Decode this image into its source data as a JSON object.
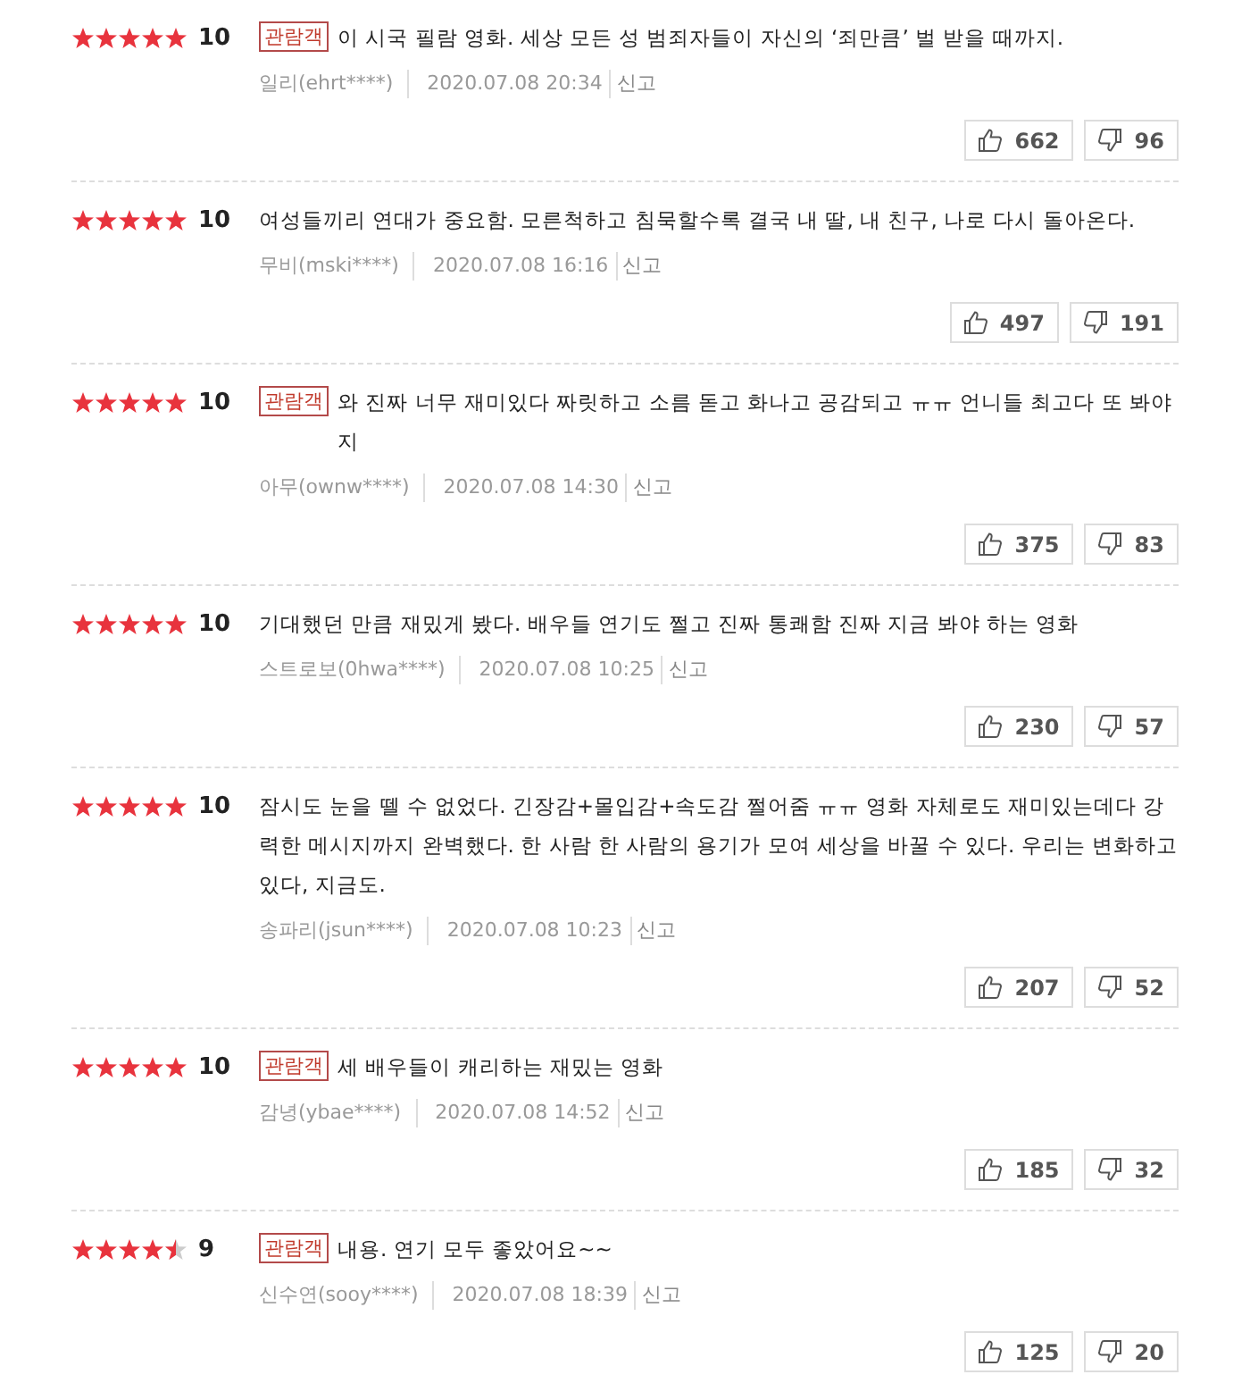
{
  "reviews": [
    {
      "stars": 5,
      "score": "10",
      "viewer_badge": "관람객",
      "text": "이 시국 필람 영화. 세상 모든 성 범죄자들이 자신의 ‘죄만큼’ 벌 받을 때까지.",
      "author": "일리(ehrt****)",
      "date": "2020.07.08 20:34",
      "report": "신고",
      "likes": "662",
      "dislikes": "96"
    },
    {
      "stars": 5,
      "score": "10",
      "text": "여성들끼리 연대가 중요함. 모른척하고 침묵할수록 결국 내 딸, 내 친구, 나로 다시 돌아온다.",
      "author": "무비(mski****)",
      "date": "2020.07.08 16:16",
      "report": "신고",
      "likes": "497",
      "dislikes": "191"
    },
    {
      "stars": 5,
      "score": "10",
      "viewer_badge": "관람객",
      "text": "와 진짜 너무 재미있다 짜릿하고 소름 돋고 화나고 공감되고 ㅠㅠ 언니들 최고다 또 봐야지",
      "author": "아무(ownw****)",
      "date": "2020.07.08 14:30",
      "report": "신고",
      "likes": "375",
      "dislikes": "83"
    },
    {
      "stars": 5,
      "score": "10",
      "text": "기대했던 만큼 재밌게 봤다. 배우들 연기도 쩔고 진짜 통쾌함 진짜 지금 봐야 하는 영화",
      "author": "스트로보(0hwa****)",
      "date": "2020.07.08 10:25",
      "report": "신고",
      "likes": "230",
      "dislikes": "57"
    },
    {
      "stars": 5,
      "score": "10",
      "text": "잠시도 눈을 뗄 수 없었다. 긴장감+몰입감+속도감 쩔어줌 ㅠㅠ 영화 자체로도 재미있는데다 강력한 메시지까지 완벽했다. 한 사람 한 사람의 용기가 모여 세상을 바꿀 수 있다. 우리는 변화하고 있다, 지금도.",
      "author": "송파리(jsun****)",
      "date": "2020.07.08 10:23",
      "report": "신고",
      "likes": "207",
      "dislikes": "52"
    },
    {
      "stars": 5,
      "score": "10",
      "viewer_badge": "관람객",
      "text": "세 배우들이 캐리하는 재밌는 영화",
      "author": "감녕(ybae****)",
      "date": "2020.07.08 14:52",
      "report": "신고",
      "likes": "185",
      "dislikes": "32"
    },
    {
      "stars": 4.5,
      "score": "9",
      "viewer_badge": "관람객",
      "text": "내용. 연기 모두 좋았어요~~",
      "author": "신수연(sooy****)",
      "date": "2020.07.08 18:39",
      "report": "신고",
      "likes": "125",
      "dislikes": "20"
    }
  ]
}
